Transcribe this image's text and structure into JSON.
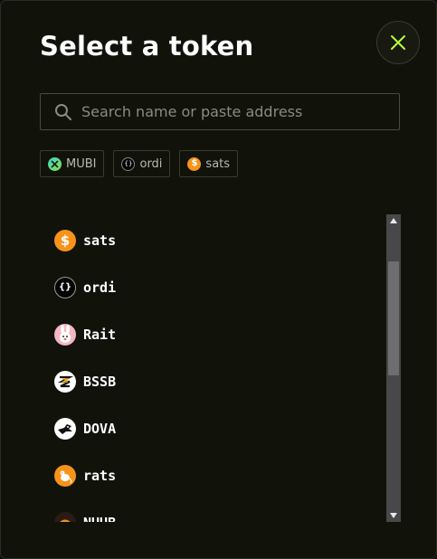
{
  "modal": {
    "title": "Select a token",
    "close_icon": "close-icon",
    "accent": "#b6ff3b"
  },
  "search": {
    "placeholder": "Search name or paste address",
    "value": "",
    "icon": "search-icon"
  },
  "quick_tokens": [
    {
      "label": "MUBI",
      "icon": "mubi-logo-icon"
    },
    {
      "label": "ordi",
      "icon": "ordi-logo-icon"
    },
    {
      "label": "sats",
      "icon": "sats-logo-icon"
    }
  ],
  "tokens": [
    {
      "symbol": "sats",
      "icon": "sats-logo-icon"
    },
    {
      "symbol": "ordi",
      "icon": "ordi-logo-icon"
    },
    {
      "symbol": "Rait",
      "icon": "rait-logo-icon"
    },
    {
      "symbol": "BSSB",
      "icon": "bssb-logo-icon"
    },
    {
      "symbol": "DOVA",
      "icon": "dova-logo-icon"
    },
    {
      "symbol": "rats",
      "icon": "rats-logo-icon"
    },
    {
      "symbol": "NUUB",
      "icon": "nuub-logo-icon"
    }
  ],
  "scrollbar": {
    "position": 0.15
  }
}
